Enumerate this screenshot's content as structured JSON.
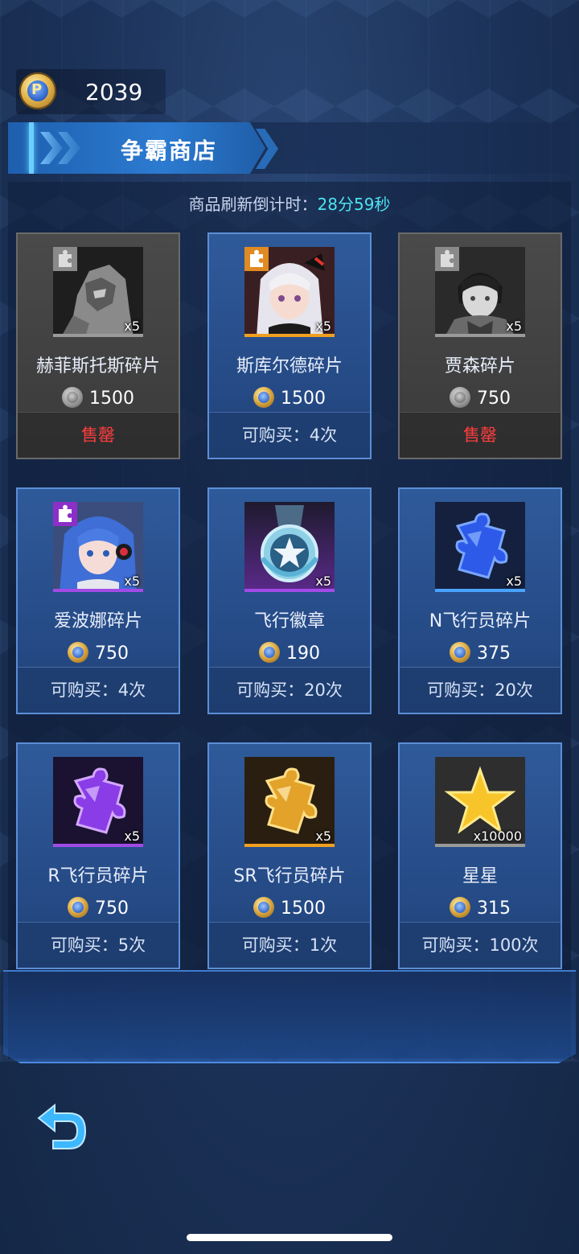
{
  "currency": {
    "icon": "trophy-coin-icon",
    "amount": "2039"
  },
  "title": "争霸商店",
  "refresh": {
    "label": "商品刷新倒计时：",
    "time": "28分59秒"
  },
  "items": [
    {
      "name": "赫菲斯托斯碎片",
      "price": "1500",
      "qty": "x5",
      "status": "售罄",
      "sold_out": true,
      "icon": "mech-pilot-portrait-icon"
    },
    {
      "name": "斯库尔德碎片",
      "price": "1500",
      "qty": "x5",
      "status": "可购买：4次",
      "sold_out": false,
      "icon": "silver-hair-girl-portrait-icon"
    },
    {
      "name": "贾森碎片",
      "price": "750",
      "qty": "x5",
      "status": "售罄",
      "sold_out": true,
      "icon": "dark-hair-boy-portrait-icon"
    },
    {
      "name": "爱波娜碎片",
      "price": "750",
      "qty": "x5",
      "status": "可购买：4次",
      "sold_out": false,
      "icon": "blue-hair-girl-portrait-icon"
    },
    {
      "name": "飞行徽章",
      "price": "190",
      "qty": "x5",
      "status": "可购买：20次",
      "sold_out": false,
      "icon": "star-medal-icon"
    },
    {
      "name": "N飞行员碎片",
      "price": "375",
      "qty": "x5",
      "status": "可购买：20次",
      "sold_out": false,
      "icon": "blue-puzzle-icon"
    },
    {
      "name": "R飞行员碎片",
      "price": "750",
      "qty": "x5",
      "status": "可购买：5次",
      "sold_out": false,
      "icon": "purple-puzzle-icon"
    },
    {
      "name": "SR飞行员碎片",
      "price": "1500",
      "qty": "x5",
      "status": "可购买：1次",
      "sold_out": false,
      "icon": "gold-puzzle-icon"
    },
    {
      "name": "星星",
      "price": "315",
      "qty": "x10000",
      "status": "可购买：100次",
      "sold_out": false,
      "icon": "gold-star-icon"
    }
  ],
  "colors": {
    "sold_out_text": "#ff3d3d",
    "refresh_time": "#4de3f0",
    "card_blue": "#2f5a9a",
    "card_gray": "#4a4a4a"
  },
  "nav": {
    "back_icon": "back-arrow-icon"
  }
}
